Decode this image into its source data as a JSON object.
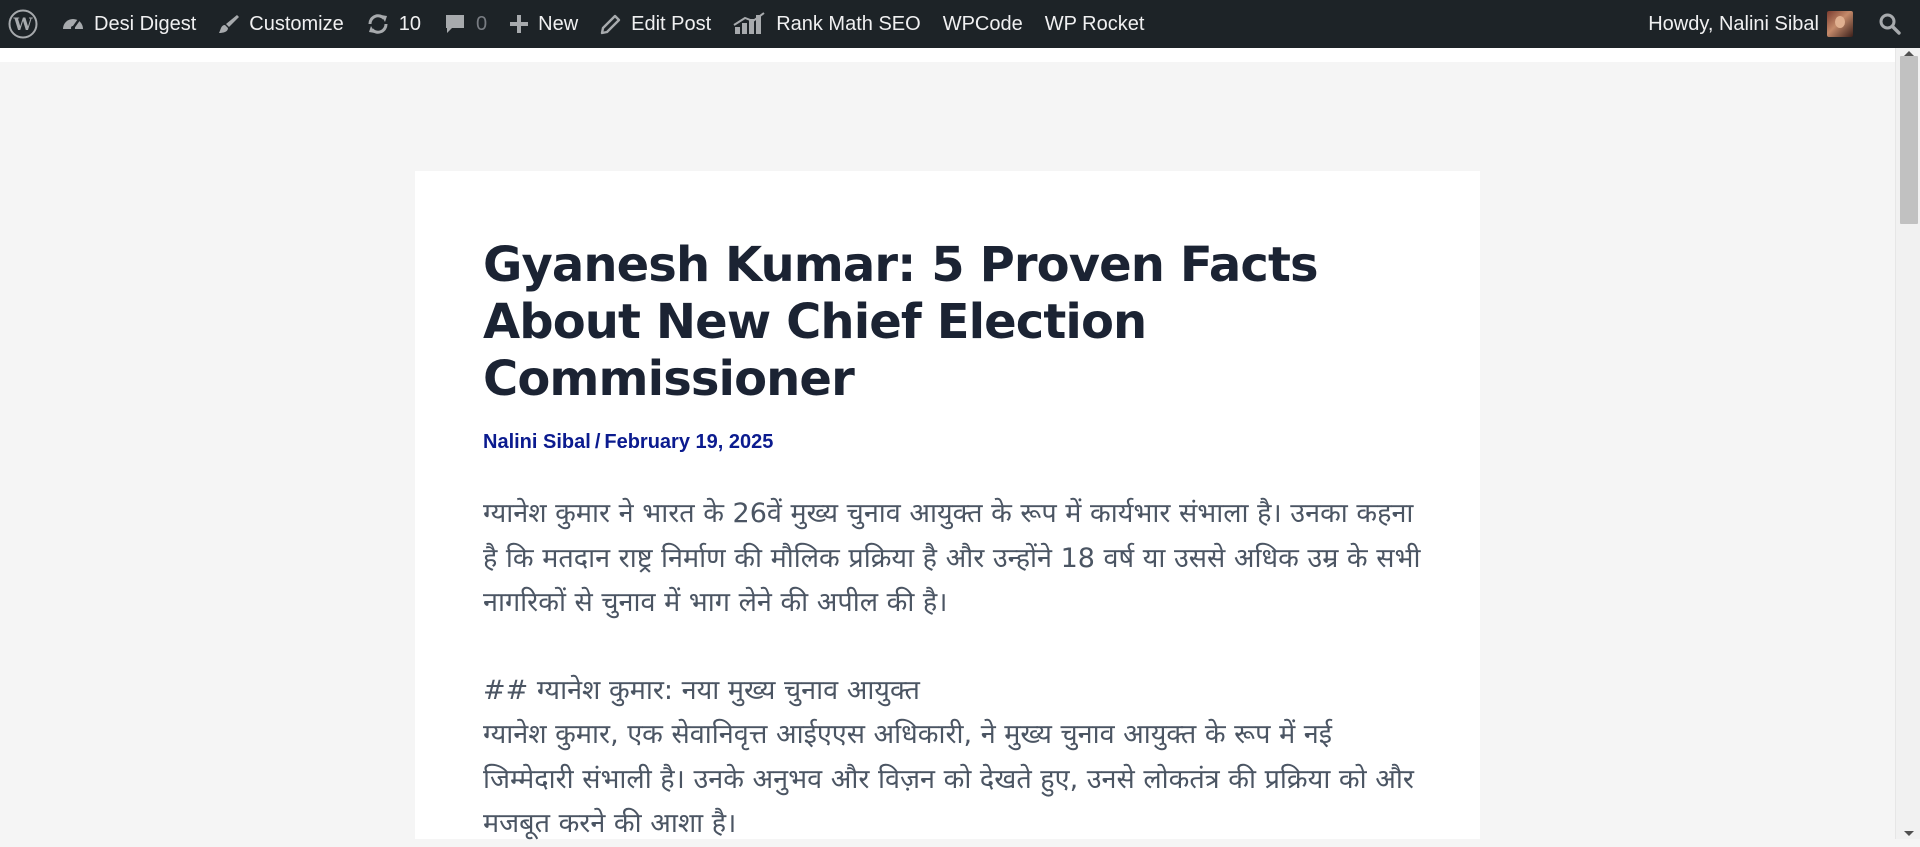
{
  "adminbar": {
    "site_name": "Desi Digest",
    "customize_label": "Customize",
    "updates_count": "10",
    "comments_count": "0",
    "new_label": "New",
    "edit_post_label": "Edit Post",
    "rank_math_label": "Rank Math SEO",
    "wpcode_label": "WPCode",
    "wprocket_label": "WP Rocket",
    "howdy_label": "Howdy, Nalini Sibal",
    "icons": [
      "wordpress-logo",
      "dashboard-icon",
      "brush-icon",
      "updates-icon",
      "comment-icon",
      "plus-icon",
      "pencil-icon",
      "rank-math-icon",
      "avatar",
      "search-icon"
    ],
    "background_color": "#1d2327"
  },
  "post": {
    "title": "Gyanesh Kumar: 5 Proven Facts About New Chief Election Commissioner",
    "author": "Nalini Sibal",
    "separator": "/",
    "date": "February 19, 2025",
    "paragraph1": "ग्यानेश कुमार ने भारत के 26वें मुख्य चुनाव आयुक्त के रूप में कार्यभार संभाला है। उनका कहना है कि मतदान राष्ट्र निर्माण की मौलिक प्रक्रिया है और उन्होंने 18 वर्ष या उससे अधिक उम्र के सभी नागरिकों से चुनाव में भाग लेने की अपील की है।",
    "heading_line": "## ग्यानेश कुमार: नया मुख्य चुनाव आयुक्त",
    "paragraph2": "ग्यानेश कुमार, एक सेवानिवृत्त आईएएस अधिकारी, ने मुख्य चुनाव आयुक्त के रूप में नई जिम्मेदारी संभाली है। उनके अनुभव और विज़न को देखते हुए, उनसे लोकतंत्र की प्रक्रिया को और मजबूत करने की आशा है।",
    "title_color": "#1b2333",
    "meta_color": "#0b1b8f",
    "body_color": "#4b5563"
  }
}
